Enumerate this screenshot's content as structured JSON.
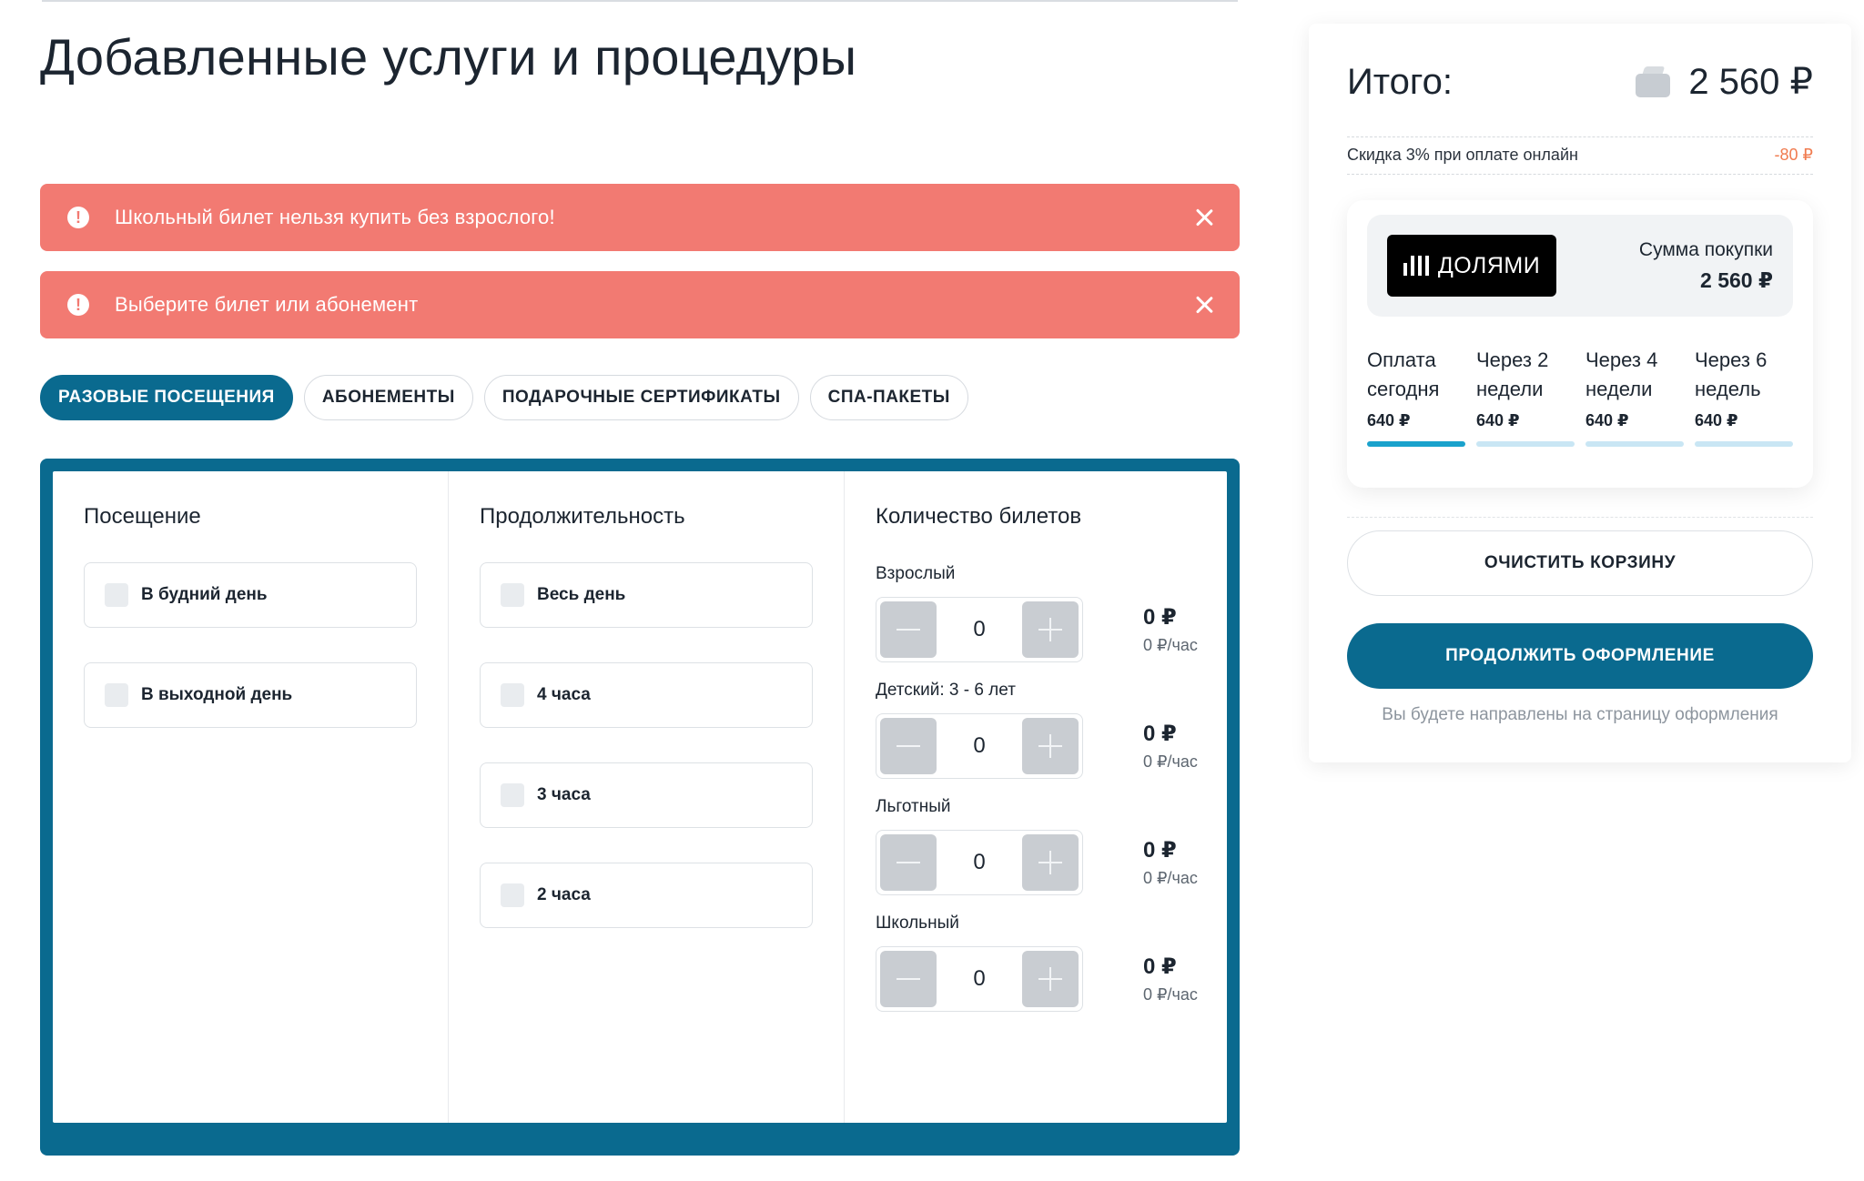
{
  "page": {
    "title": "Добавленные услуги и процедуры"
  },
  "alerts": [
    {
      "text": "Школьный билет нельзя купить без взрослого!"
    },
    {
      "text": "Выберите билет или абонемент"
    }
  ],
  "tabs": [
    {
      "label": "РАЗОВЫЕ ПОСЕЩЕНИЯ",
      "active": true
    },
    {
      "label": "АБОНЕМЕНТЫ",
      "active": false
    },
    {
      "label": "ПОДАРОЧНЫЕ СЕРТИФИКАТЫ",
      "active": false
    },
    {
      "label": "СПА-ПАКЕТЫ",
      "active": false
    }
  ],
  "visit": {
    "title": "Посещение",
    "options": [
      {
        "label": "В будний день",
        "checked": false
      },
      {
        "label": "В выходной день",
        "checked": false
      }
    ]
  },
  "duration": {
    "title": "Продолжительность",
    "options": [
      {
        "label": "Весь день",
        "checked": false
      },
      {
        "label": "4 часа",
        "checked": false
      },
      {
        "label": "3 часа",
        "checked": false
      },
      {
        "label": "2 часа",
        "checked": false
      }
    ]
  },
  "tickets": {
    "title": "Количество билетов",
    "items": [
      {
        "label": "Взрослый",
        "quantity": "0",
        "price": "0 ₽",
        "rate": "0 ₽/час"
      },
      {
        "label": "Детский: 3 - 6 лет",
        "quantity": "0",
        "price": "0 ₽",
        "rate": "0 ₽/час"
      },
      {
        "label": "Льготный",
        "quantity": "0",
        "price": "0 ₽",
        "rate": "0 ₽/час"
      },
      {
        "label": "Школьный",
        "quantity": "0",
        "price": "0 ₽",
        "rate": "0 ₽/час"
      }
    ]
  },
  "summary": {
    "title": "Итого:",
    "total": "2 560 ₽",
    "discount_text": "Скидка 3% при оплате онлайн",
    "discount_value": "-80 ₽",
    "dolyami": {
      "logo_text": "ДОЛЯМИ",
      "purchase_label": "Сумма покупки",
      "purchase_amount": "2 560 ₽",
      "installments": [
        {
          "label": "Оплата сегодня",
          "amount": "640 ₽",
          "active": true
        },
        {
          "label": "Через 2 недели",
          "amount": "640 ₽",
          "active": false
        },
        {
          "label": "Через 4 недели",
          "amount": "640 ₽",
          "active": false
        },
        {
          "label": "Через 6 недель",
          "amount": "640 ₽",
          "active": false
        }
      ]
    },
    "clear_label": "ОЧИСТИТЬ КОРЗИНУ",
    "continue_label": "ПРОДОЛЖИТЬ ОФОРМЛЕНИЕ",
    "redirect_note": "Вы будете направлены на страницу оформления"
  },
  "colors": {
    "brand": "#0a6a8f",
    "alert": "#f27a72",
    "discount": "#f07b4f",
    "installment_active": "#1aa2cc",
    "installment_inactive": "#c9e6f4"
  },
  "icons": {
    "alert": "exclamation-circle-icon",
    "close": "close-icon",
    "wallet": "wallet-icon",
    "minus": "minus-icon",
    "plus": "plus-icon",
    "dolyami": "dolyami-bars-icon"
  }
}
